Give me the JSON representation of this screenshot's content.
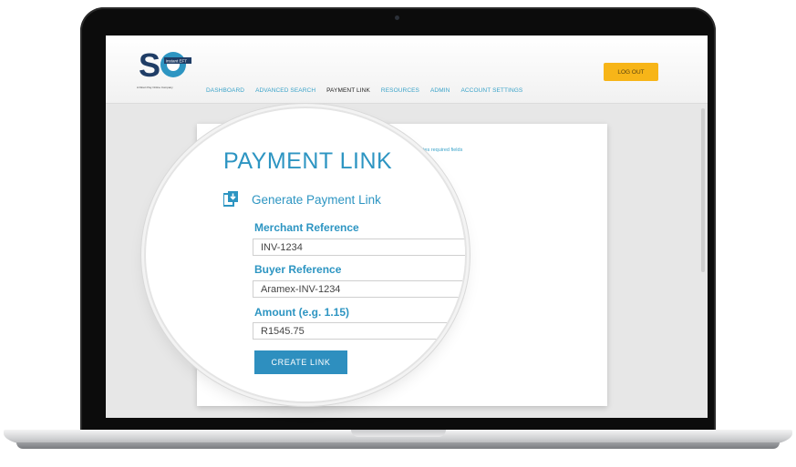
{
  "header": {
    "logo_tag": "A Direct Pay Online Company",
    "logo_badge": "instant EFT",
    "logout_label": "LOG OUT"
  },
  "nav": {
    "items": [
      {
        "label": "DASHBOARD"
      },
      {
        "label": "ADVANCED SEARCH"
      },
      {
        "label": "PAYMENT LINK"
      },
      {
        "label": "RESOURCES"
      },
      {
        "label": "ADMIN"
      },
      {
        "label": "ACCOUNT SETTINGS"
      }
    ],
    "active": "PAYMENT LINK"
  },
  "page": {
    "title": "PAYMENT LINK",
    "required_note": "* denotes required fields",
    "section_title": "Generate Payment Link"
  },
  "form": {
    "merchant_reference": {
      "label": "Merchant Reference",
      "value": "INV-1234"
    },
    "buyer_reference": {
      "label": "Buyer Reference",
      "value": "Aramex-INV-1234"
    },
    "amount": {
      "label": "Amount (e.g. 1.15)",
      "value": "R1545.75"
    },
    "submit_label": "CREATE LINK"
  },
  "colors": {
    "accent": "#2d95c2",
    "button": "#2e8fbf",
    "logout": "#f7b518"
  }
}
